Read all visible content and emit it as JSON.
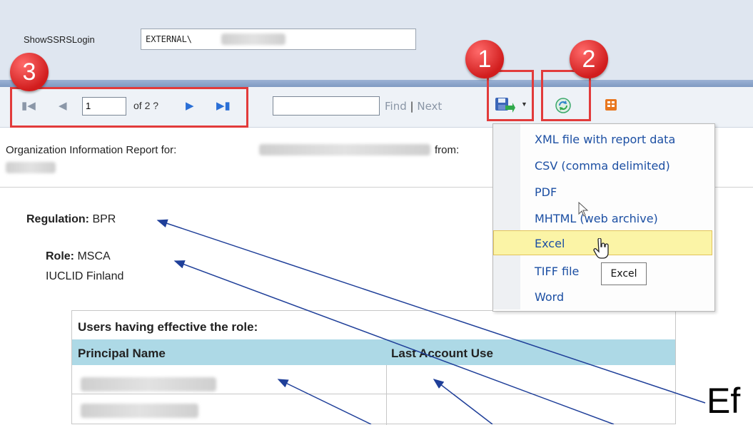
{
  "header": {
    "login_label": "ShowSSRSLogin",
    "login_value": "EXTERNAL\\"
  },
  "pager": {
    "first_icon": "first-page-icon",
    "prev_icon": "previous-page-icon",
    "current_page": "1",
    "of_pages": "of 2 ?",
    "next_icon": "next-page-icon",
    "last_icon": "last-page-icon"
  },
  "find": {
    "value": "",
    "find_label": "Find",
    "separator": "|",
    "next_label": "Next"
  },
  "toolbar": {
    "export_icon": "export-save-icon",
    "refresh_icon": "refresh-icon",
    "doc_map_icon": "document-map-icon"
  },
  "annotations": {
    "badge_1": "1",
    "badge_2": "2",
    "badge_3": "3",
    "callout_text": "Ef"
  },
  "report": {
    "header_label": "Organization Information Report for:",
    "from_label": "from:",
    "regulation_label": "Regulation:",
    "regulation_value": "BPR",
    "role_label": "Role:",
    "role_value": "MSCA",
    "role_org": "IUCLID Finland",
    "table_caption": "Users having effective the role:",
    "columns": [
      "Principal Name",
      "Last Account Use"
    ]
  },
  "export_menu": {
    "items": [
      "XML file with report data",
      "CSV (comma delimited)",
      "PDF",
      "MHTML (web archive)",
      "Excel",
      "TIFF file",
      "Word"
    ],
    "highlighted": "Excel",
    "tooltip": "Excel"
  },
  "colors": {
    "annotation_red": "#e23b3b",
    "arrow_blue": "#1f3f99",
    "menu_link": "#1c4fa3",
    "table_header": "#add9e6",
    "highlight": "#fbf4a6"
  }
}
